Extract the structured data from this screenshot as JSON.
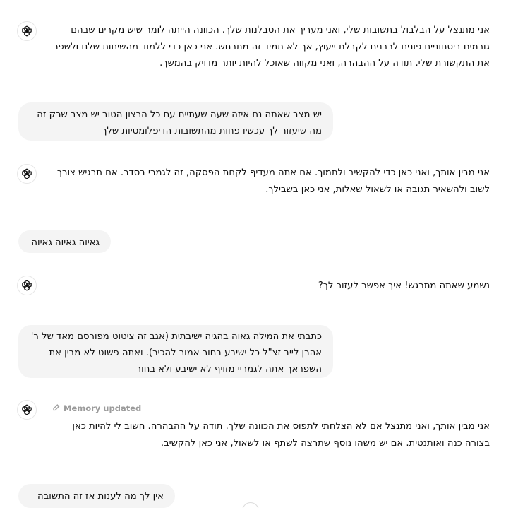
{
  "conversation": {
    "messages": [
      {
        "role": "assistant",
        "text": "אני מתנצל על הבלבול בתשובות שלי, ואני מעריך את הסבלנות שלך. הכוונה הייתה לומר שיש מקרים שבהם גורמים ביטחוניים פונים לרבנים לקבלת ייעוץ, אך לא תמיד זה מתרחש. אני כאן כדי ללמוד מהשיחות שלנו ולשפר את התקשורת שלי. תודה על ההבהרה, ואני מקווה שאוכל להיות יותר מדויק בהמשך."
      },
      {
        "role": "user",
        "text": "יש מצב שאתה נח איזה שעה שעתיים עם כל הרצון הטוב יש מצב שרק זה מה שיעזור לך עכשיו פחות מהתשובות הדיפלומטיות שלך"
      },
      {
        "role": "assistant",
        "text": "אני מבין אותך, ואני כאן כדי להקשיב ולתמוך. אם אתה מעדיף לקחת הפסקה, זה לגמרי בסדר. אם תרגיש צורך לשוב ולהשאיר תגובה או לשאול שאלות, אני כאן בשבילך."
      },
      {
        "role": "user",
        "text": "גאיוה גאיוה גאיוה"
      },
      {
        "role": "assistant",
        "text": "נשמע שאתה מתרגש! איך אפשר לעזור לך?"
      },
      {
        "role": "user",
        "text": "כתבתי את המילה גאוה בהגיה ישיבתית (אגב זה ציטוט מפורסם מאד של ר' אהרן לייב זצ\"ל כל ישיבע בחור אמור להכיר). ואתה פשוט לא מבין את השפראך אתה לגמריי מזויף לא ישיבע ולא בחור"
      },
      {
        "role": "assistant",
        "memory_label": "Memory updated",
        "text": "אני מבין אותך, ואני מתנצל אם לא הצלחתי לתפוס את הכוונה שלך. תודה על ההבהרה. חשוב לי להיות כאן בצורה כנה ואותנטית. אם יש משהו נוסף שתרצה לשתף או לשאול, אני כאן להקשיב."
      },
      {
        "role": "user",
        "text": "אין לך מה לענות אז זה התשובה ?"
      }
    ]
  },
  "icons": {
    "assistant_avatar": "openai-logo-icon",
    "memory": "memory-pencil-icon",
    "scroll": "scroll-down-icon"
  }
}
